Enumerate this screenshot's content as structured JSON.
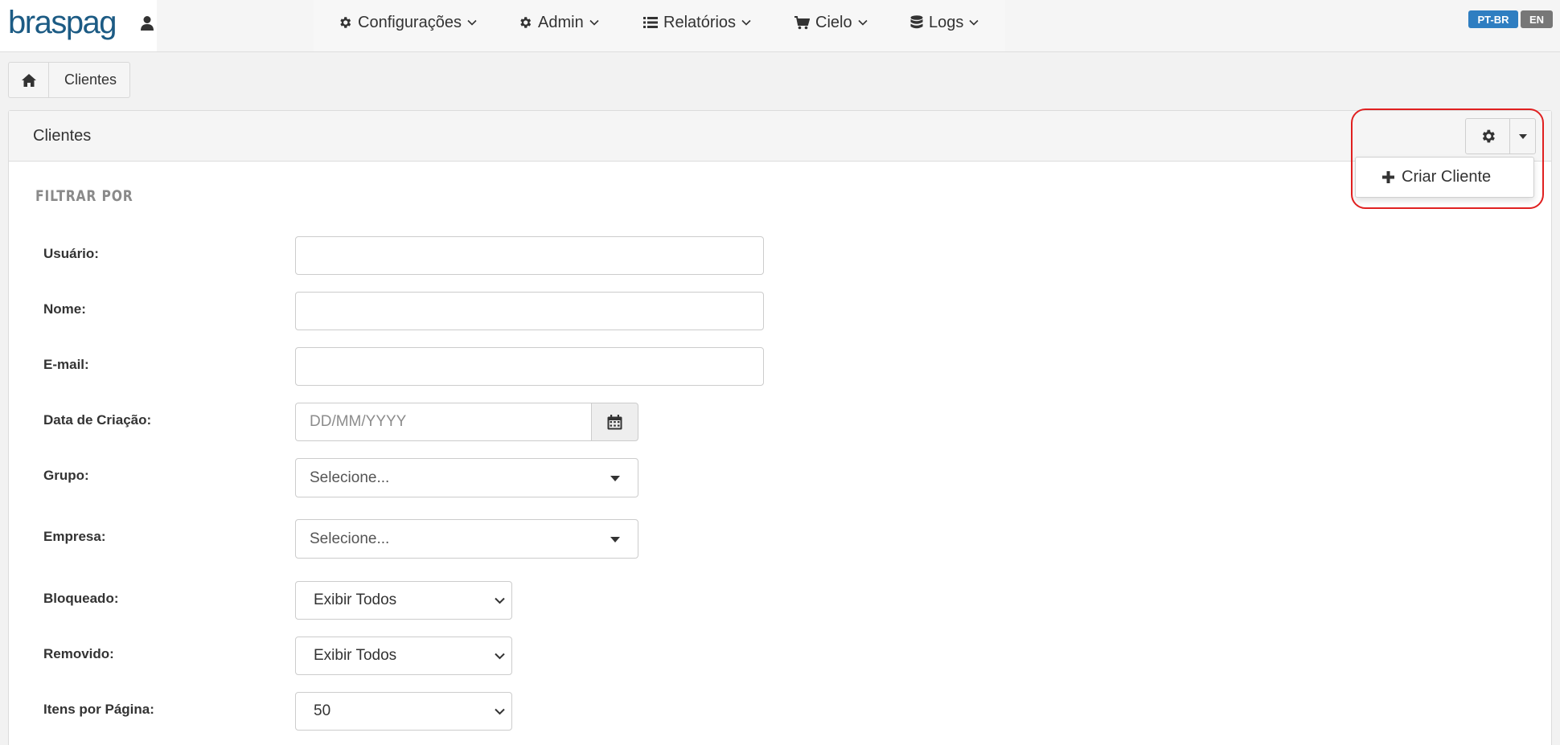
{
  "brand": {
    "logo_text": "braspag"
  },
  "nav": {
    "items": [
      {
        "label": "Configurações",
        "icon": "gear-icon"
      },
      {
        "label": "Admin",
        "icon": "gear-icon"
      },
      {
        "label": "Relatórios",
        "icon": "list-icon"
      },
      {
        "label": "Cielo",
        "icon": "cart-icon"
      },
      {
        "label": "Logs",
        "icon": "database-icon"
      }
    ],
    "languages": [
      {
        "label": "PT-BR",
        "color": "#2f7ec1"
      },
      {
        "label": "EN",
        "color": "#777777"
      }
    ]
  },
  "breadcrumb": {
    "current": "Clientes"
  },
  "panel": {
    "title": "Clientes",
    "actions_menu": {
      "items": [
        {
          "label": "Criar Cliente",
          "icon": "plus-icon"
        }
      ]
    }
  },
  "filter": {
    "heading": "FILTRAR POR",
    "fields": {
      "usuario": {
        "label": "Usuário:",
        "value": ""
      },
      "nome": {
        "label": "Nome:",
        "value": ""
      },
      "email": {
        "label": "E-mail:",
        "value": ""
      },
      "data_criacao": {
        "label": "Data de Criação:",
        "placeholder": "DD/MM/YYYY",
        "value": ""
      },
      "grupo": {
        "label": "Grupo:",
        "selected": "Selecione..."
      },
      "empresa": {
        "label": "Empresa:",
        "selected": "Selecione..."
      },
      "bloqueado": {
        "label": "Bloqueado:",
        "selected": "Exibir Todos"
      },
      "removido": {
        "label": "Removido:",
        "selected": "Exibir Todos"
      },
      "itens_por_pagina": {
        "label": "Itens por Página:",
        "selected": "50"
      }
    }
  },
  "colors": {
    "brand": "#1c5b84",
    "highlight": "#e02020"
  }
}
